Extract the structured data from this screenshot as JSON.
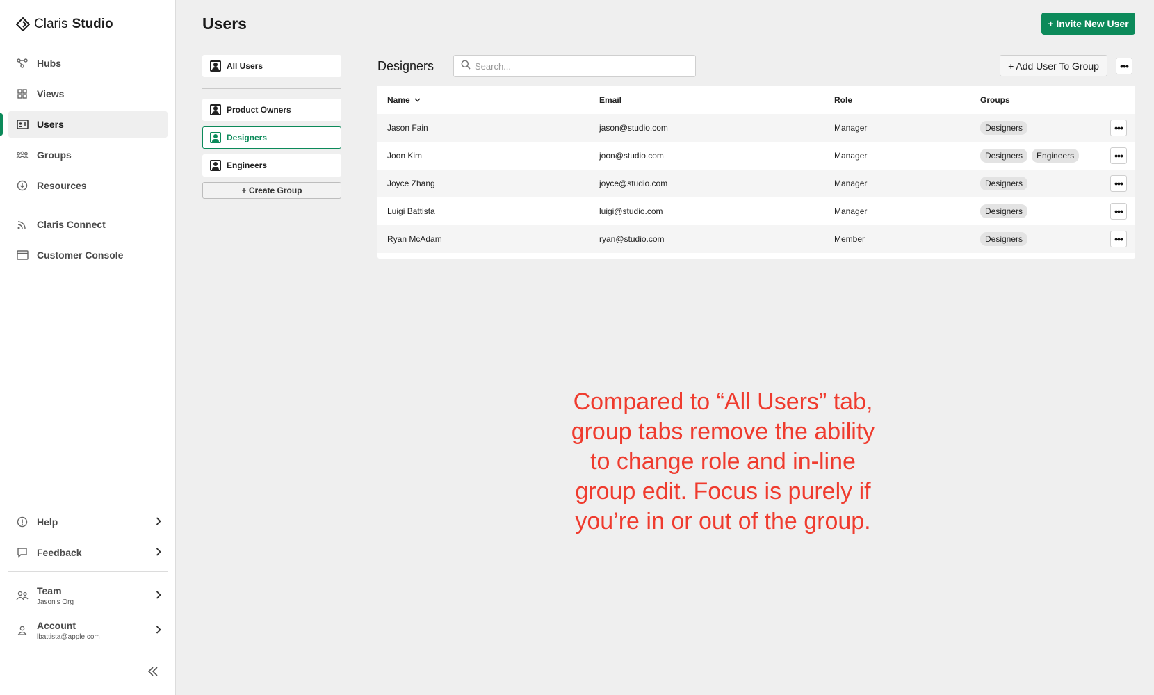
{
  "app": {
    "logo_text": "Claris",
    "logo_bold": "Studio"
  },
  "sidebar": {
    "nav": [
      {
        "label": "Hubs",
        "icon": "hubs-icon"
      },
      {
        "label": "Views",
        "icon": "views-icon"
      },
      {
        "label": "Users",
        "icon": "users-icon",
        "active": true
      },
      {
        "label": "Groups",
        "icon": "groups-icon"
      },
      {
        "label": "Resources",
        "icon": "resources-icon"
      }
    ],
    "secondary": [
      {
        "label": "Claris Connect",
        "icon": "connect-icon"
      },
      {
        "label": "Customer Console",
        "icon": "console-icon"
      }
    ],
    "help": {
      "label": "Help"
    },
    "feedback": {
      "label": "Feedback"
    },
    "team": {
      "label": "Team",
      "sub": "Jason's Org"
    },
    "account": {
      "label": "Account",
      "sub": "lbattista@apple.com"
    }
  },
  "page": {
    "title": "Users",
    "invite_label": "+ Invite New User"
  },
  "groups": {
    "all": "All Users",
    "items": [
      "Product Owners",
      "Designers",
      "Engineers"
    ],
    "create_label": "+ Create Group"
  },
  "content": {
    "section_title": "Designers",
    "search_placeholder": "Search...",
    "add_user_label": "+ Add User To Group",
    "more": "•••",
    "columns": {
      "name": "Name",
      "email": "Email",
      "role": "Role",
      "groups": "Groups"
    },
    "rows": [
      {
        "name": "Jason Fain",
        "email": "jason@studio.com",
        "role": "Manager",
        "groups": [
          "Designers"
        ]
      },
      {
        "name": "Joon Kim",
        "email": "joon@studio.com",
        "role": "Manager",
        "groups": [
          "Designers",
          "Engineers"
        ]
      },
      {
        "name": "Joyce Zhang",
        "email": "joyce@studio.com",
        "role": "Manager",
        "groups": [
          "Designers"
        ]
      },
      {
        "name": "Luigi Battista",
        "email": "luigi@studio.com",
        "role": "Manager",
        "groups": [
          "Designers"
        ]
      },
      {
        "name": "Ryan McAdam",
        "email": "ryan@studio.com",
        "role": "Member",
        "groups": [
          "Designers"
        ]
      }
    ]
  },
  "annotation": {
    "lines": [
      "Compared to “All Users” tab,",
      "group tabs remove the ability",
      "to change role and in-line",
      "group edit. Focus is purely if",
      "you’re in or out of the group."
    ]
  },
  "colors": {
    "accent": "#0c8a5a",
    "annotation": "#ef3b2e"
  }
}
